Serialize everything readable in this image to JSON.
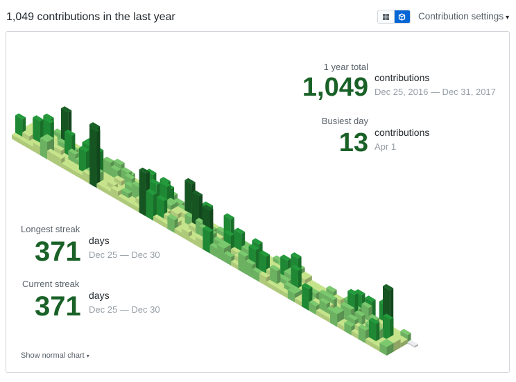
{
  "header": {
    "title": "1,049 contributions in the last year",
    "settings_label": "Contribution settings",
    "caret": "▾"
  },
  "stats": {
    "year_total": {
      "label": "1 year total",
      "value": "1,049",
      "unit": "contributions",
      "range": "Dec 25, 2016 — Dec 31, 2017"
    },
    "busiest_day": {
      "label": "Busiest day",
      "value": "13",
      "unit": "contributions",
      "date": "Apr 1"
    },
    "longest_streak": {
      "label": "Longest streak",
      "value": "371",
      "unit": "days",
      "range": "Dec 25 — Dec 30"
    },
    "current_streak": {
      "label": "Current streak",
      "value": "371",
      "unit": "days",
      "range": "Dec 25 — Dec 30"
    }
  },
  "footer": {
    "label": "Show normal chart",
    "caret": "▾"
  },
  "colors": {
    "level1": "#c6e48b",
    "level2": "#7bc96f",
    "level3": "#239a3b",
    "level4": "#196127",
    "empty": "#ebedf0",
    "big_number": "#196127",
    "toggle_active": "#0366d6"
  },
  "icons": {
    "grid_view": "grid-icon",
    "cube_view": "cube-icon"
  },
  "chart_data": {
    "type": "isometric-contribution-calendar",
    "weeks": 54,
    "days_per_week": 7,
    "total": 1049,
    "max_day": 13,
    "busiest_day": "Apr 1",
    "range": [
      "Dec 25, 2016",
      "Dec 31, 2017"
    ]
  }
}
